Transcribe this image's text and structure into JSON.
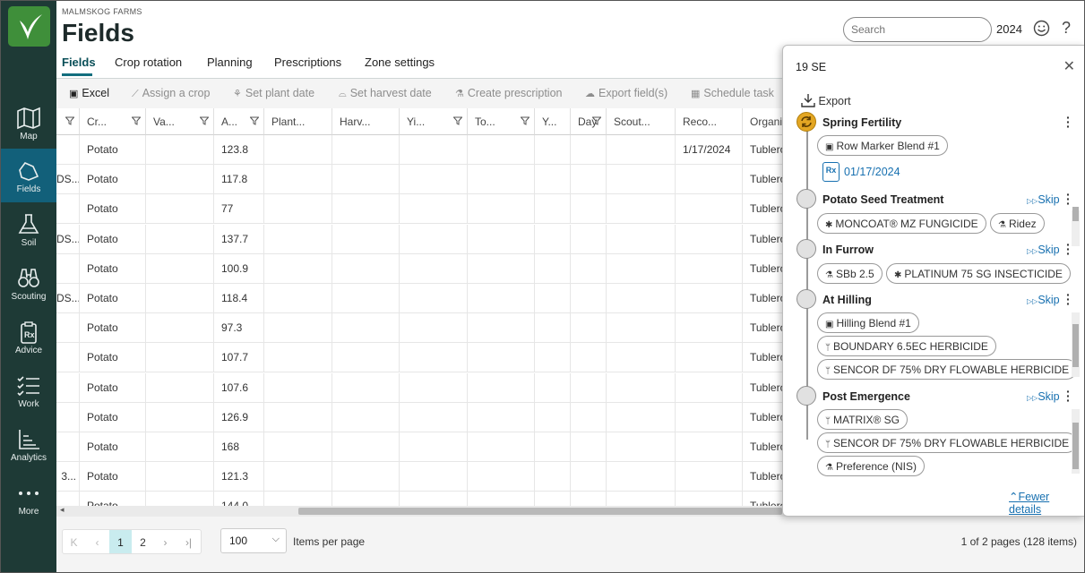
{
  "app": {
    "farm_name": "MALMSKOG FARMS",
    "page_title": "Fields"
  },
  "nav": {
    "items": [
      {
        "label": "Map",
        "icon": "map-icon"
      },
      {
        "label": "Fields",
        "icon": "fields-icon",
        "active": true
      },
      {
        "label": "Soil",
        "icon": "flask-icon"
      },
      {
        "label": "Scouting",
        "icon": "binoculars-icon"
      },
      {
        "label": "Advice",
        "icon": "rx-clipboard-icon"
      },
      {
        "label": "Work",
        "icon": "checklist-icon"
      },
      {
        "label": "Analytics",
        "icon": "chart-icon"
      },
      {
        "label": "More",
        "icon": "more-icon"
      }
    ]
  },
  "tabs": [
    "Fields",
    "Crop rotation",
    "Planning",
    "Prescriptions",
    "Zone settings"
  ],
  "search": {
    "placeholder": "Search"
  },
  "year": "2024",
  "toolbar": {
    "excel": "Excel",
    "assign_crop": "Assign a crop",
    "set_plant_date": "Set plant date",
    "set_harvest_date": "Set harvest date",
    "create_prescription": "Create prescription",
    "export_fields": "Export field(s)",
    "schedule_task": "Schedule task"
  },
  "table": {
    "headers": [
      "",
      "Cr...",
      "Va...",
      "A...",
      "Plant...",
      "Harv...",
      "Yi...",
      "To...",
      "Y...",
      "Day",
      "Scout...",
      "Reco...",
      "Organi..."
    ],
    "rows": [
      {
        "c0": "",
        "crop": "Potato",
        "area": "123.8",
        "reco": "1/17/2024",
        "org": "Tublero"
      },
      {
        "c0": "DS...",
        "crop": "Potato",
        "area": "117.8",
        "reco": "",
        "org": "Tublero"
      },
      {
        "c0": "",
        "crop": "Potato",
        "area": "77",
        "reco": "",
        "org": "Tublero"
      },
      {
        "c0": "DS...",
        "crop": "Potato",
        "area": "137.7",
        "reco": "",
        "org": "Tublero"
      },
      {
        "c0": "",
        "crop": "Potato",
        "area": "100.9",
        "reco": "",
        "org": "Tublero"
      },
      {
        "c0": "DS...",
        "crop": "Potato",
        "area": "118.4",
        "reco": "",
        "org": "Tublero"
      },
      {
        "c0": "",
        "crop": "Potato",
        "area": "97.3",
        "reco": "",
        "org": "Tublero"
      },
      {
        "c0": "",
        "crop": "Potato",
        "area": "107.7",
        "reco": "",
        "org": "Tublero"
      },
      {
        "c0": "",
        "crop": "Potato",
        "area": "107.6",
        "reco": "",
        "org": "Tublero"
      },
      {
        "c0": "",
        "crop": "Potato",
        "area": "126.9",
        "reco": "",
        "org": "Tublero"
      },
      {
        "c0": "",
        "crop": "Potato",
        "area": "168",
        "reco": "",
        "org": "Tublero"
      },
      {
        "c0": "3...",
        "crop": "Potato",
        "area": "121.3",
        "reco": "",
        "org": "Tublero"
      },
      {
        "c0": "",
        "crop": "Potato",
        "area": "144.0",
        "reco": "",
        "org": "Tublero"
      }
    ]
  },
  "pagination": {
    "pages": [
      "1",
      "2"
    ],
    "current": "1",
    "per_page": "100",
    "per_page_label": "Items per page",
    "info": "1 of 2 pages (128 items)"
  },
  "panel": {
    "title": "19 SE",
    "export": "Export",
    "skip_label": "Skip",
    "fewer_details": "Fewer details",
    "stages": [
      {
        "title": "Spring Fertility",
        "chips": [
          "Row Marker Blend #1"
        ],
        "rx_date": "01/17/2024"
      },
      {
        "title": "Potato Seed Treatment",
        "chips": [
          "MONCOAT® MZ FUNGICIDE",
          "Ridez"
        ]
      },
      {
        "title": "In Furrow",
        "chips": [
          "SBb 2.5",
          "PLATINUM 75 SG INSECTICIDE"
        ]
      },
      {
        "title": "At Hilling",
        "chips": [
          "Hilling Blend #1",
          "BOUNDARY 6.5EC HERBICIDE",
          "SENCOR DF 75% DRY FLOWABLE HERBICIDE"
        ]
      },
      {
        "title": "Post Emergence",
        "chips": [
          "MATRIX® SG",
          "SENCOR DF 75% DRY FLOWABLE HERBICIDE",
          "Preference (NIS)"
        ]
      }
    ]
  }
}
